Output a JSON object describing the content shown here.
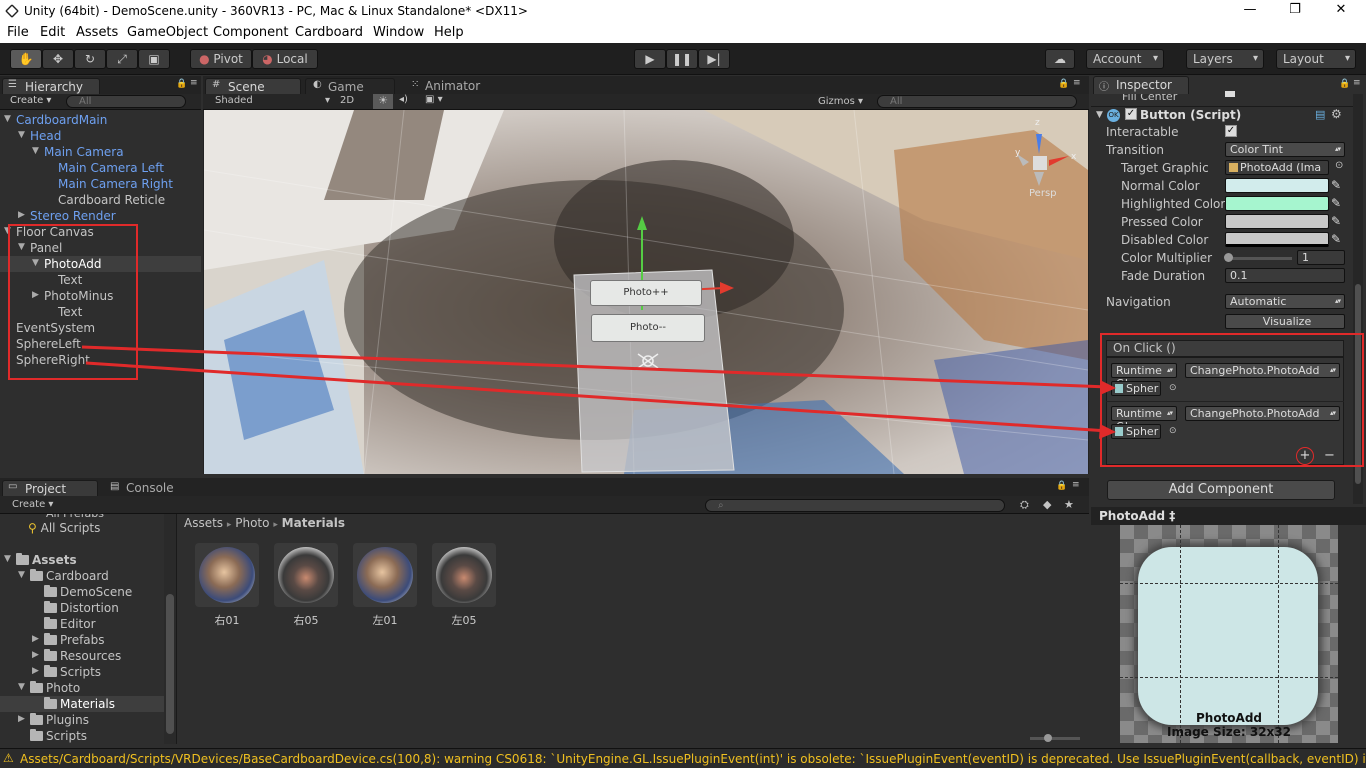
{
  "window": {
    "title": "Unity (64bit) - DemoScene.unity - 360VR13 - PC, Mac & Linux Standalone* <DX11>",
    "min": "—",
    "max": "❐",
    "close": "✕"
  },
  "menu": [
    "File",
    "Edit",
    "Assets",
    "GameObject",
    "Component",
    "Cardboard",
    "Window",
    "Help"
  ],
  "toolbar": {
    "pivot": "Pivot",
    "local": "Local",
    "account": "Account",
    "layers": "Layers",
    "layout": "Layout"
  },
  "hierarchy": {
    "tab": "Hierarchy",
    "create": "Create",
    "search": "All",
    "items": [
      "CardboardMain",
      "Head",
      "Main Camera",
      "Main Camera Left",
      "Main Camera Right",
      "Cardboard Reticle",
      "Stereo Render",
      "Floor Canvas",
      "Panel",
      "PhotoAdd",
      "Text",
      "PhotoMinus",
      "Text",
      "EventSystem",
      "SphereLeft",
      "SphereRight"
    ]
  },
  "scene": {
    "tabs": [
      "Scene",
      "Game",
      "Animator"
    ],
    "shading": "Shaded",
    "mode2d": "2D",
    "gizmos": "Gizmos",
    "search": "All",
    "persp": "Persp",
    "axis_y": "y",
    "axis_x": "x",
    "axis_z": "z",
    "btn_add": "Photo++",
    "btn_minus": "Photo--"
  },
  "inspector": {
    "tab": "Inspector",
    "cutoff": "Fill Center",
    "component": "Button (Script)",
    "interactable": "Interactable",
    "transition_label": "Transition",
    "transition": "Color Tint",
    "target_label": "Target Graphic",
    "target": "PhotoAdd (Ima",
    "normal": "Normal Color",
    "highlighted": "Highlighted Color",
    "pressed": "Pressed Color",
    "disabled": "Disabled Color",
    "multiplier": "Color Multiplier",
    "multiplier_val": "1",
    "fade": "Fade Duration",
    "fade_val": "0.1",
    "navigation": "Navigation",
    "navigation_val": "Automatic",
    "visualize": "Visualize",
    "onclick": "On Click ()",
    "runtime": "Runtime C‡",
    "func": "ChangePhoto.PhotoAdd",
    "obj": "Spher",
    "plus": "+",
    "minus": "−",
    "add_component": "Add Component",
    "preview_title": "PhotoAdd ‡",
    "preview_name": "PhotoAdd",
    "preview_size": "Image Size: 32x32",
    "colors": {
      "normal": "#d2ecec",
      "highlighted": "#a6f5cf",
      "pressed": "#c8c8c8",
      "disabled": "#c8c8c8"
    }
  },
  "project": {
    "tabs": [
      "Project",
      "Console"
    ],
    "create": "Create",
    "cut": "All Prefabs",
    "all_scripts": "All Scripts",
    "tree": [
      "Assets",
      "Cardboard",
      "DemoScene",
      "Distortion",
      "Editor",
      "Prefabs",
      "Resources",
      "Scripts",
      "Photo",
      "Materials",
      "Plugins",
      "Scripts"
    ],
    "breadcrumb": [
      "Assets",
      "Photo",
      "Materials"
    ],
    "sep": "▸",
    "assets": [
      "右01",
      "右05",
      "左01",
      "左05"
    ]
  },
  "status": {
    "text": "Assets/Cardboard/Scripts/VRDevices/BaseCardboardDevice.cs(100,8): warning CS0618: `UnityEngine.GL.IssuePluginEvent(int)' is obsolete: `IssuePluginEvent(eventID) is deprecated. Use IssuePluginEvent(callback, eventID) instead.'"
  }
}
